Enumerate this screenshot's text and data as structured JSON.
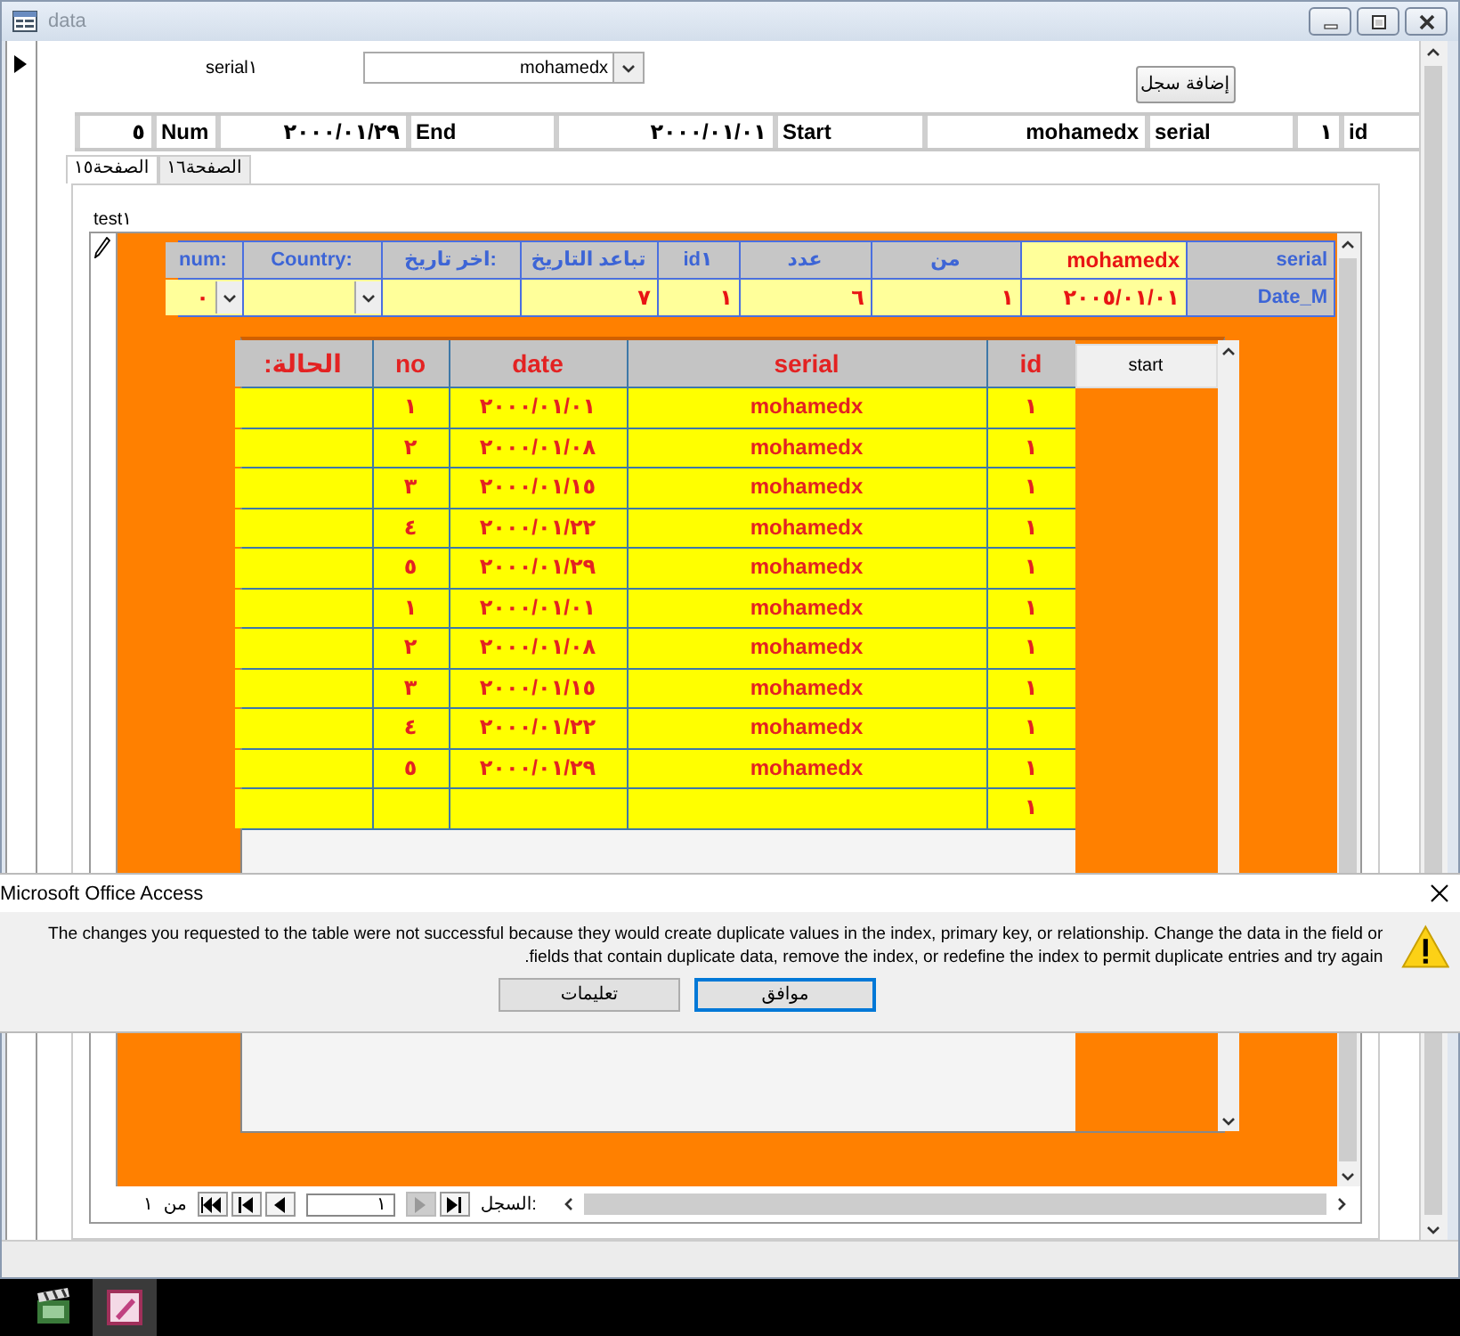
{
  "window": {
    "title": "data"
  },
  "header": {
    "label": "serial١",
    "combo_value": "mohamedx",
    "add_button": "إضافة سجل"
  },
  "summary_fields": [
    {
      "label": "id",
      "value": "١"
    },
    {
      "label": "serial",
      "value": "mohamedx"
    },
    {
      "label": "Start",
      "value": "٢٠٠٠/٠١/٠١"
    },
    {
      "label": "End",
      "value": "٢٠٠٠/٠١/٢٩"
    },
    {
      "label": "Num",
      "value": "٥"
    }
  ],
  "tabs": [
    {
      "label": "الصفحة١٦",
      "selected": false
    },
    {
      "label": "الصفحة١٥",
      "selected": true
    }
  ],
  "subform": {
    "caption": "test١",
    "grid": [
      [
        {
          "kind": "label",
          "text": "serial"
        },
        {
          "kind": "value",
          "text": "mohamedx"
        },
        {
          "kind": "label",
          "text": "من"
        },
        {
          "kind": "label",
          "text": "عدد"
        },
        {
          "kind": "label",
          "text": "id١"
        },
        {
          "kind": "label",
          "text": "تباعد التاريخ"
        },
        {
          "kind": "label",
          "text": "اخر تاريخ:"
        },
        {
          "kind": "label",
          "text": "Country:"
        },
        {
          "kind": "label",
          "text": "num:"
        }
      ],
      [
        {
          "kind": "label",
          "text": "Date_M"
        },
        {
          "kind": "value",
          "text": "٢٠٠٥/٠١/٠١"
        },
        {
          "kind": "value",
          "text": "١"
        },
        {
          "kind": "value",
          "text": "٦"
        },
        {
          "kind": "value",
          "text": "١"
        },
        {
          "kind": "value",
          "text": "٧"
        },
        {
          "kind": "value"
        },
        {
          "kind": "combo"
        },
        {
          "kind": "combo",
          "text": "٠"
        }
      ]
    ],
    "datasheet": {
      "columns": [
        "id",
        "serial",
        "date",
        "no",
        "الحالة:"
      ],
      "rows": [
        [
          "١",
          "mohamedx",
          "٢٠٠٠/٠١/٠١",
          "١"
        ],
        [
          "١",
          "mohamedx",
          "٢٠٠٠/٠١/٠٨",
          "٢"
        ],
        [
          "١",
          "mohamedx",
          "٢٠٠٠/٠١/١٥",
          "٣"
        ],
        [
          "١",
          "mohamedx",
          "٢٠٠٠/٠١/٢٢",
          "٤"
        ],
        [
          "١",
          "mohamedx",
          "٢٠٠٠/٠١/٢٩",
          "٥"
        ],
        [
          "١",
          "mohamedx",
          "٢٠٠٠/٠١/٠١",
          "١"
        ],
        [
          "١",
          "mohamedx",
          "٢٠٠٠/٠١/٠٨",
          "٢"
        ],
        [
          "١",
          "mohamedx",
          "٢٠٠٠/٠١/١٥",
          "٣"
        ],
        [
          "١",
          "mohamedx",
          "٢٠٠٠/٠١/٢٢",
          "٤"
        ],
        [
          "١",
          "mohamedx",
          "٢٠٠٠/٠١/٢٩",
          "٥"
        ],
        [
          "١"
        ]
      ]
    },
    "start_button": "start",
    "nav": {
      "total": "١",
      "of_label": "من",
      "current": "١",
      "label": "السجل:",
      "previous_disabled": true
    }
  },
  "dialog": {
    "title": "Microsoft Office Access",
    "message": "The changes you requested to the table were not successful because they would create duplicate values in the index, primary key, or relationship.  Change the data in the field or fields that contain duplicate data, remove the index, or redefine the index to permit duplicate entries and try again.",
    "buttons": [
      {
        "label": "موافق",
        "default": true
      },
      {
        "label": "تعليمات",
        "default": false
      }
    ]
  }
}
